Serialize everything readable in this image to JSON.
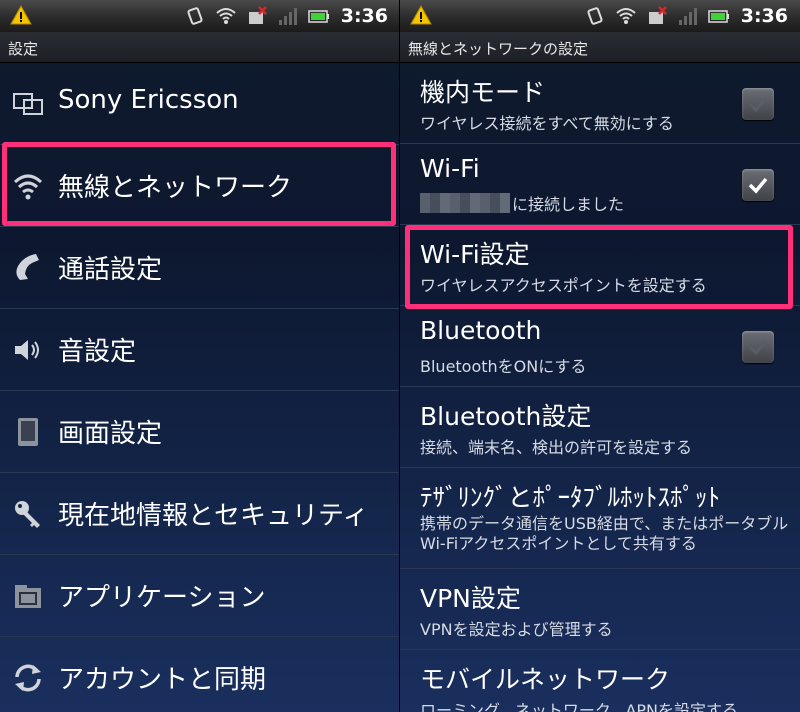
{
  "status": {
    "time": "3:36",
    "icons": [
      "warning-icon",
      "vibrate-icon",
      "wifi-icon",
      "sim-error-icon",
      "signal-icon",
      "battery-icon"
    ]
  },
  "left": {
    "title": "設定",
    "items": [
      {
        "label": "Sony Ericsson",
        "icon": "sony-ericsson-icon"
      },
      {
        "label": "無線とネットワーク",
        "icon": "wireless-icon"
      },
      {
        "label": "通話設定",
        "icon": "phone-icon"
      },
      {
        "label": "音設定",
        "icon": "speaker-icon"
      },
      {
        "label": "画面設定",
        "icon": "display-icon"
      },
      {
        "label": "現在地情報とセキュリティ",
        "icon": "key-icon"
      },
      {
        "label": "アプリケーション",
        "icon": "applications-icon"
      },
      {
        "label": "アカウントと同期",
        "icon": "sync-icon"
      }
    ]
  },
  "right": {
    "title": "無線とネットワークの設定",
    "items": [
      {
        "title": "機内モード",
        "subtitle": "ワイヤレス接続をすべて無効にする",
        "checked": true
      },
      {
        "title": "Wi-Fi",
        "subtitle": "に接続しました",
        "checked": true
      },
      {
        "title": "Wi-Fi設定",
        "subtitle": "ワイヤレスアクセスポイントを設定する"
      },
      {
        "title": "Bluetooth",
        "subtitle": "BluetoothをONにする",
        "checked": false
      },
      {
        "title": "Bluetooth設定",
        "subtitle": "接続、端末名、検出の許可を設定する"
      },
      {
        "title": "ﾃｻﾞﾘﾝｸﾞとﾎﾟｰﾀﾌﾞﾙﾎｯﾄｽﾎﾟｯﾄ",
        "subtitle": "携帯のデータ通信をUSB経由で、またはポータブルWi-Fiアクセスポイントとして共有する"
      },
      {
        "title": "VPN設定",
        "subtitle": "VPNを設定および管理する"
      },
      {
        "title": "モバイルネットワーク",
        "subtitle": "ローミング、ネットワーク、APNを設定する"
      }
    ]
  },
  "colors": {
    "highlight": "#ff2f7a",
    "background_top": "#0f1a2d",
    "background_bottom": "#1a2f5e"
  }
}
